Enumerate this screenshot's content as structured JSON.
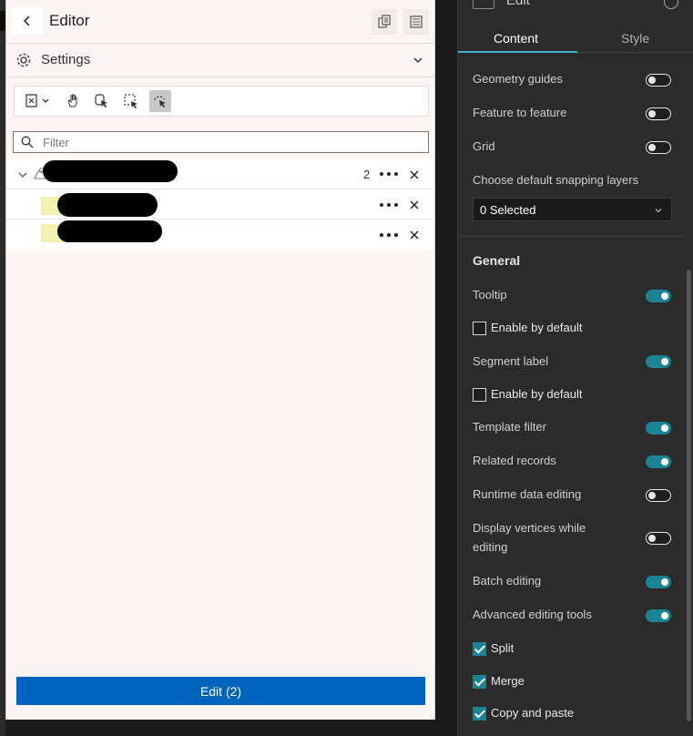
{
  "editor": {
    "title": "Editor",
    "settings_label": "Settings",
    "filter_placeholder": "Filter",
    "layer_count": "2",
    "edit_button_label": "Edit (2)"
  },
  "panel": {
    "header_title": "Edit",
    "tabs": [
      {
        "label": "Content",
        "active": true
      },
      {
        "label": "Style",
        "active": false
      }
    ],
    "snapping": {
      "geometry_guides": {
        "label": "Geometry guides",
        "on": false
      },
      "feature_to_feature": {
        "label": "Feature to feature",
        "on": false
      },
      "grid": {
        "label": "Grid",
        "on": false
      },
      "layers_label": "Choose default snapping layers",
      "layers_value": "0 Selected"
    },
    "general": {
      "title": "General",
      "tooltip": {
        "label": "Tooltip",
        "on": true
      },
      "tooltip_enable": {
        "label": "Enable by default",
        "checked": false
      },
      "segment_label": {
        "label": "Segment label",
        "on": true
      },
      "segment_enable": {
        "label": "Enable by default",
        "checked": false
      },
      "template_filter": {
        "label": "Template filter",
        "on": true
      },
      "related_records": {
        "label": "Related records",
        "on": true
      },
      "runtime_data_editing": {
        "label": "Runtime data editing",
        "on": false
      },
      "display_vertices": {
        "label_line1": "Display vertices while",
        "label_line2": "editing",
        "on": false
      },
      "batch_editing": {
        "label": "Batch editing",
        "on": true
      },
      "advanced_tools": {
        "label": "Advanced editing tools",
        "on": true
      },
      "split": {
        "label": "Split",
        "checked": true
      },
      "merge": {
        "label": "Merge",
        "checked": true
      },
      "copy_paste": {
        "label": "Copy and paste",
        "checked": true
      }
    }
  },
  "colors": {
    "accent": "#1a8394",
    "primary_button": "#0064bf",
    "tab_underline": "#3bb0c9"
  }
}
